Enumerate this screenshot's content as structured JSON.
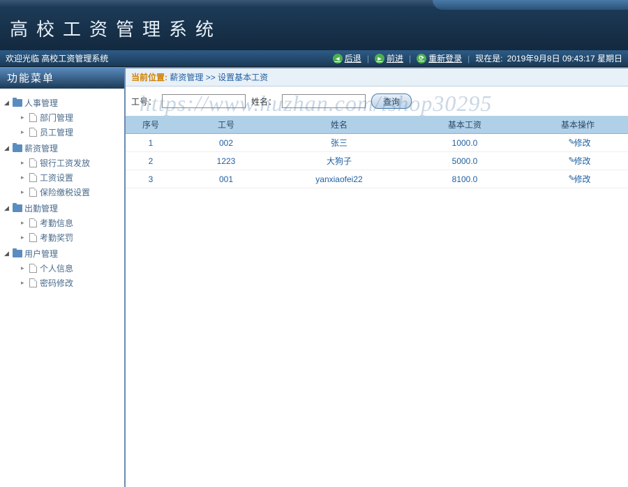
{
  "header": {
    "title": "高校工资管理系统"
  },
  "topbar": {
    "welcome": "欢迎光临 高校工资管理系统",
    "back": "后退",
    "forward": "前进",
    "relogin": "重新登录",
    "datetime_prefix": "现在是:",
    "datetime": "2019年9月8日 09:43:17 星期日"
  },
  "sidebar": {
    "title": "功能菜单",
    "groups": [
      {
        "label": "人事管理",
        "items": [
          "部门管理",
          "员工管理"
        ]
      },
      {
        "label": "薪资管理",
        "items": [
          "银行工资发放",
          "工资设置",
          "保险缴税设置"
        ]
      },
      {
        "label": "出勤管理",
        "items": [
          "考勤信息",
          "考勤奖罚"
        ]
      },
      {
        "label": "用户管理",
        "items": [
          "个人信息",
          "密码修改"
        ]
      }
    ]
  },
  "breadcrumb": {
    "label": "当前位置:",
    "path1": "薪资管理",
    "sep": ">>",
    "path2": "设置基本工资"
  },
  "search": {
    "emp_no_label": "工号：",
    "emp_no_value": "",
    "name_label": "姓名：",
    "name_value": "",
    "query_button": "查询"
  },
  "grid": {
    "headers": [
      "序号",
      "工号",
      "姓名",
      "基本工资",
      "基本操作"
    ],
    "edit_label": "修改",
    "rows": [
      {
        "index": "1",
        "emp_no": "002",
        "name": "张三",
        "salary": "1000.0"
      },
      {
        "index": "2",
        "emp_no": "1223",
        "name": "大狗子",
        "salary": "5000.0"
      },
      {
        "index": "3",
        "emp_no": "001",
        "name": "yanxiaofei22",
        "salary": "8100.0"
      }
    ]
  },
  "watermark": "https://www.huzhan.com/ishop30295"
}
